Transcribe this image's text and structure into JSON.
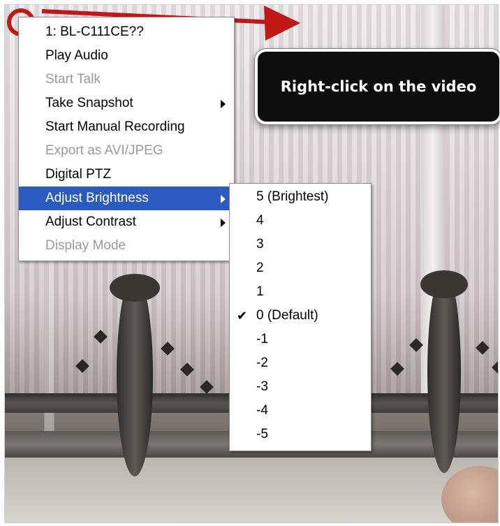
{
  "tooltip": {
    "text": "Right-click on the video"
  },
  "context_menu": {
    "items": [
      {
        "label": "1: BL-C111CE??",
        "disabled": false,
        "has_submenu": false,
        "selected": false
      },
      {
        "label": "Play Audio",
        "disabled": false,
        "has_submenu": false,
        "selected": false
      },
      {
        "label": "Start Talk",
        "disabled": true,
        "has_submenu": false,
        "selected": false
      },
      {
        "label": "Take Snapshot",
        "disabled": false,
        "has_submenu": true,
        "selected": false
      },
      {
        "label": "Start Manual Recording",
        "disabled": false,
        "has_submenu": false,
        "selected": false
      },
      {
        "label": "Export as AVI/JPEG",
        "disabled": true,
        "has_submenu": false,
        "selected": false
      },
      {
        "label": "Digital PTZ",
        "disabled": false,
        "has_submenu": false,
        "selected": false
      },
      {
        "label": "Adjust Brightness",
        "disabled": false,
        "has_submenu": true,
        "selected": true
      },
      {
        "label": "Adjust Contrast",
        "disabled": false,
        "has_submenu": true,
        "selected": false
      },
      {
        "label": "Display Mode",
        "disabled": true,
        "has_submenu": false,
        "selected": false
      }
    ]
  },
  "brightness_submenu": {
    "items": [
      {
        "label": "5 (Brightest)",
        "checked": false
      },
      {
        "label": "4",
        "checked": false
      },
      {
        "label": "3",
        "checked": false
      },
      {
        "label": "2",
        "checked": false
      },
      {
        "label": "1",
        "checked": false
      },
      {
        "label": "0 (Default)",
        "checked": true
      },
      {
        "label": "-1",
        "checked": false
      },
      {
        "label": "-2",
        "checked": false
      },
      {
        "label": "-3",
        "checked": false
      },
      {
        "label": "-4",
        "checked": false
      },
      {
        "label": "-5",
        "checked": false
      }
    ],
    "check_glyph": "✔"
  },
  "colors": {
    "highlight": "#2c5bc0",
    "annotation_red": "#c01717",
    "tooltip_bg": "#0d0d0d"
  }
}
